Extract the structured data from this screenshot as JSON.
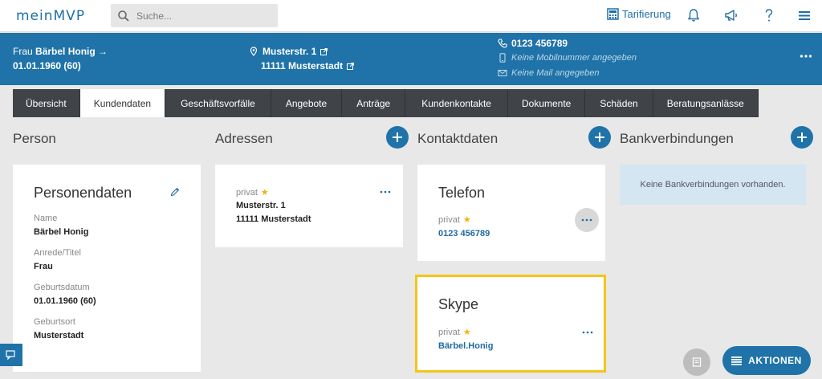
{
  "app": {
    "logo": "meinMVP"
  },
  "search": {
    "placeholder": "Suche..."
  },
  "topnav": {
    "tarifierung": "Tarifierung"
  },
  "customer": {
    "salutation": "Frau",
    "name": "Bärbel Honig",
    "dob": "01.01.1960 (60)",
    "street": "Musterstr. 1",
    "city": "11111 Musterstadt",
    "phone": "0123 456789",
    "mobile": "Keine Mobilnummer angegeben",
    "mail": "Keine Mail angegeben"
  },
  "tabs": [
    "Übersicht",
    "Kundendaten",
    "Geschäftsvorfälle",
    "Angebote",
    "Anträge",
    "Kundenkontakte",
    "Dokumente",
    "Schäden",
    "Beratungsanlässe"
  ],
  "active_tab": "Kundendaten",
  "columns": {
    "person": "Person",
    "adressen": "Adressen",
    "kontaktdaten": "Kontaktdaten",
    "bank": "Bankverbindungen"
  },
  "personendaten": {
    "title": "Personendaten",
    "name_label": "Name",
    "name_value": "Bärbel Honig",
    "anrede_label": "Anrede/Titel",
    "anrede_value": "Frau",
    "geburtsdatum_label": "Geburtsdatum",
    "geburtsdatum_value": "01.01.1960 (60)",
    "geburtsort_label": "Geburtsort",
    "geburtsort_value": "Musterstadt"
  },
  "address_card": {
    "type": "privat",
    "street": "Musterstr. 1",
    "city": "11111 Musterstadt"
  },
  "telefon_card": {
    "title": "Telefon",
    "type": "privat",
    "value": "0123 456789"
  },
  "skype_card": {
    "title": "Skype",
    "type": "privat",
    "value": "Bärbel.Honig"
  },
  "bank_info": "Keine Bankverbindungen vorhanden.",
  "actions_label": "AKTIONEN",
  "colors": {
    "primary": "#1f73a8",
    "tab_bar": "#404449",
    "highlight": "#f5c518",
    "star": "#f2b30d"
  }
}
